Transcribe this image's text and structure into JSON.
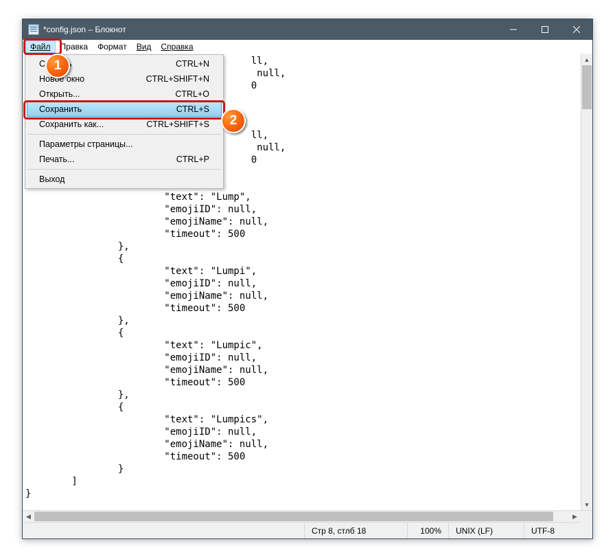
{
  "window": {
    "title": "*config.json – Блокнот"
  },
  "menubar": {
    "file": "Файл",
    "edit": "Правка",
    "format": "Формат",
    "view": "Вид",
    "help": "Справка"
  },
  "dropdown": {
    "new": {
      "label": "Создать",
      "shortcut": "CTRL+N"
    },
    "new_window": {
      "label": "Новое окно",
      "shortcut": "CTRL+SHIFT+N"
    },
    "open": {
      "label": "Открыть...",
      "shortcut": "CTRL+O"
    },
    "save": {
      "label": "Сохранить",
      "shortcut": "CTRL+S"
    },
    "save_as": {
      "label": "Сохранить как...",
      "shortcut": "CTRL+SHIFT+S"
    },
    "page_setup": {
      "label": "Параметры страницы..."
    },
    "print": {
      "label": "Печать...",
      "shortcut": "CTRL+P"
    },
    "exit": {
      "label": "Выход"
    }
  },
  "editor_text": "                                       ll,\n                                        null,\n                                       0\n\n\n\n                                       ll,\n                                        null,\n                                       0\n                },\n                {\n                        \"text\": \"Lump\",\n                        \"emojiID\": null,\n                        \"emojiName\": null,\n                        \"timeout\": 500\n                },\n                {\n                        \"text\": \"Lumpi\",\n                        \"emojiID\": null,\n                        \"emojiName\": null,\n                        \"timeout\": 500\n                },\n                {\n                        \"text\": \"Lumpic\",\n                        \"emojiID\": null,\n                        \"emojiName\": null,\n                        \"timeout\": 500\n                },\n                {\n                        \"text\": \"Lumpics\",\n                        \"emojiID\": null,\n                        \"emojiName\": null,\n                        \"timeout\": 500\n                }\n        ]\n}",
  "status": {
    "position": "Стр 8, стлб 18",
    "zoom": "100%",
    "eol": "UNIX (LF)",
    "encoding": "UTF-8"
  },
  "callouts": {
    "one": "1",
    "two": "2"
  }
}
